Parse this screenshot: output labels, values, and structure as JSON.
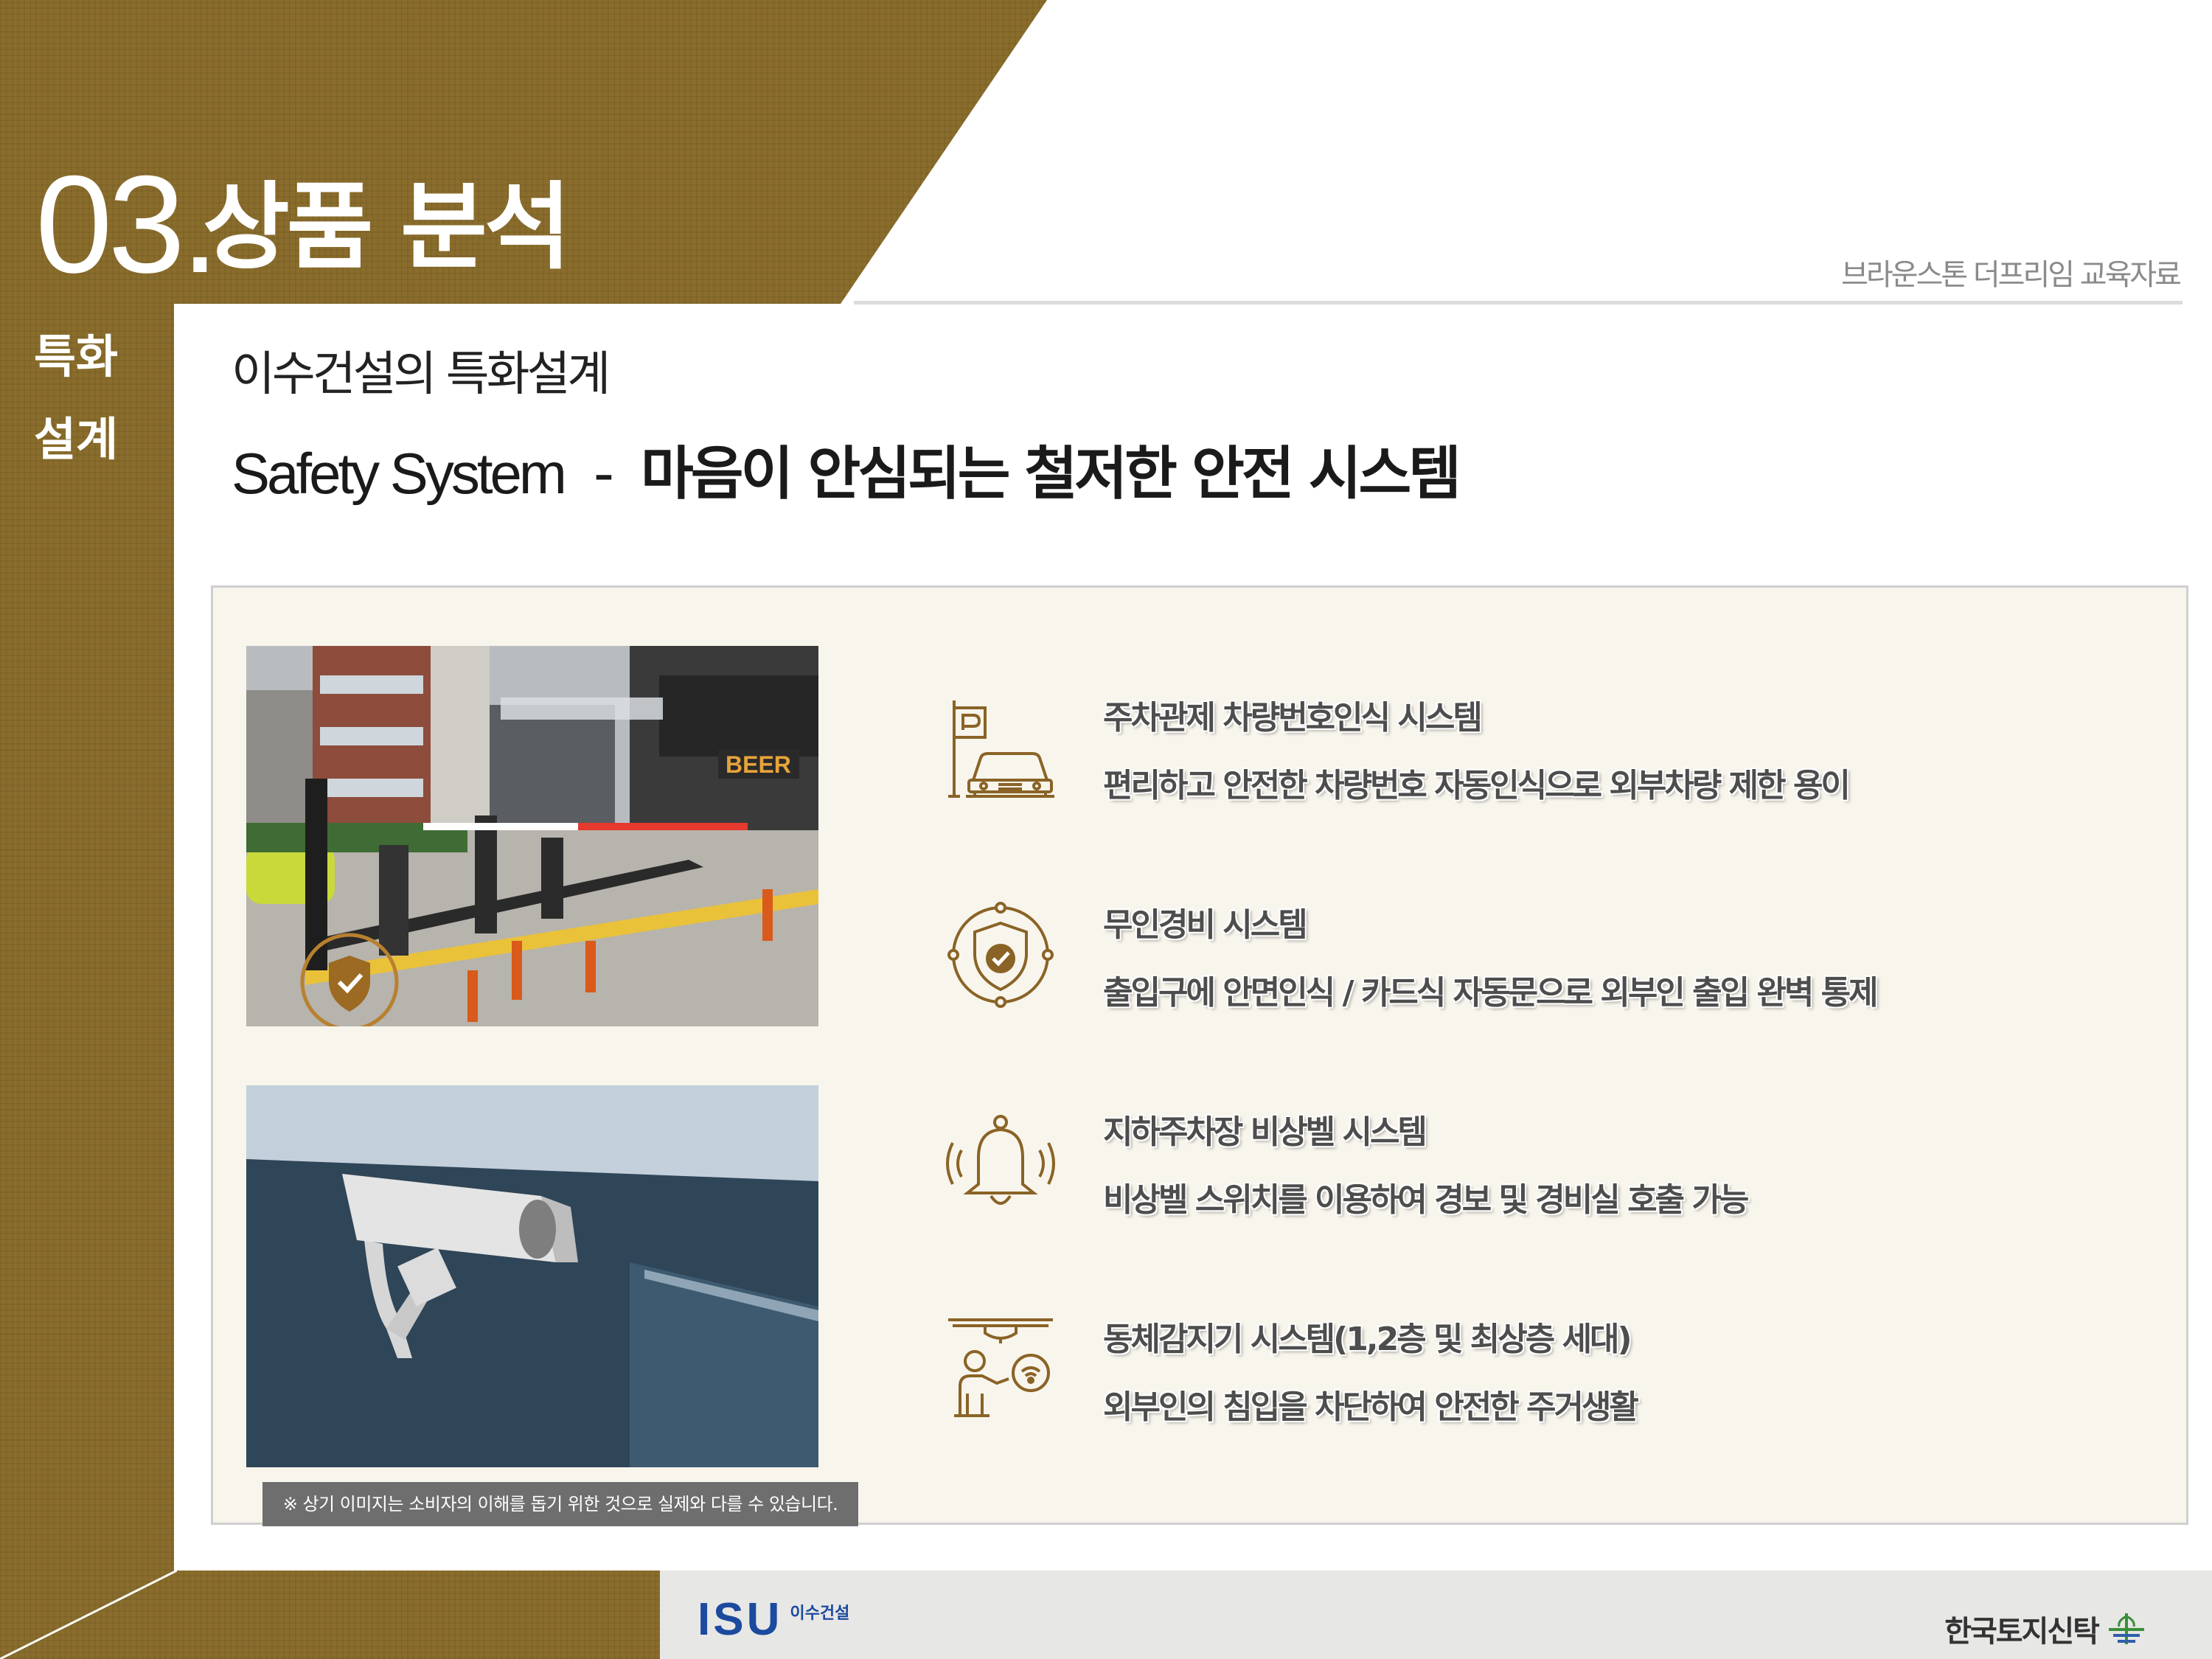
{
  "header": {
    "section_number": "03.",
    "section_title": "상품 분석",
    "side_label_line1": "특화",
    "side_label_line2": "설계",
    "doc_label": "브라운스톤 더프리임 교육자료"
  },
  "content": {
    "subtitle": "이수건설의 특화설계",
    "headline_en": "Safety System",
    "headline_dash": "-",
    "headline_kr": "마음이 안심되는 철저한 안전 시스템"
  },
  "features": [
    {
      "icon": "parking-car-icon",
      "title": "주차관제 차량번호인식 시스템",
      "desc": "편리하고 안전한 차량번호 자동인식으로 외부차량 제한 용이"
    },
    {
      "icon": "shield-check-icon",
      "title": "무인경비 시스템",
      "desc": "출입구에 안면인식 / 카드식 자동문으로 외부인 출입 완벽 통제"
    },
    {
      "icon": "bell-icon",
      "title": "지하주차장 비상벨 시스템",
      "desc": "비상벨 스위치를 이용하여 경보 및 경비실 호출 가능"
    },
    {
      "icon": "motion-sensor-icon",
      "title": "동체감지기 시스템(1,2층 및 최상층 세대)",
      "desc": "외부인의 침입을 차단하여 안전한 주거생활"
    }
  ],
  "photos": {
    "parking_sign": "BEER"
  },
  "disclaimer": "※ 상기 이미지는 소비자의 이해를 돕기 위한 것으로 실제와 다를 수 있습니다.",
  "footer": {
    "left_logo": "ISU",
    "left_logo_kr": "이수건설",
    "right_logo": "한국토지신탁"
  },
  "colors": {
    "gold": "#8a6d2c",
    "icon": "#8a6326",
    "text": "#4d4d4d"
  }
}
